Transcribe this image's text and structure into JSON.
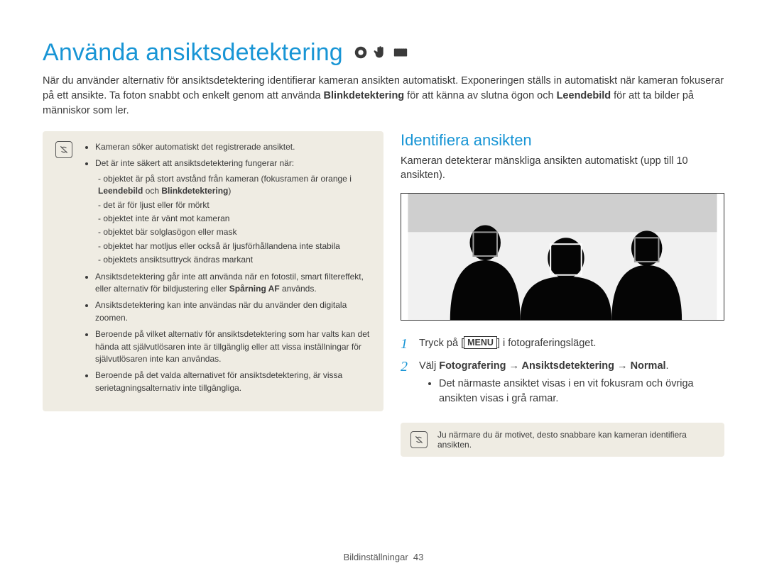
{
  "title": "Använda ansiktsdetektering",
  "title_icons": [
    "camera-mode-icon",
    "hand-icon",
    "scene-icon"
  ],
  "lead": {
    "t1": "När du använder alternativ för ansiktsdetektering identifierar kameran ansikten automatiskt. Exponeringen ställs in automatiskt när kameran fokuserar på ett ansikte. Ta foton snabbt och enkelt genom att använda ",
    "b1": "Blinkdetektering",
    "t2": " för att känna av slutna ögon och ",
    "b2": "Leendebild",
    "t3": " för att ta bilder på människor som ler."
  },
  "notes": {
    "n1": "Kameran söker automatiskt det registrerade ansiktet.",
    "n2": "Det är inte säkert att ansiktsdetektering fungerar när:",
    "sub": {
      "s1a": "objektet är på stort avstånd från kameran (fokusramen är orange i ",
      "s1b1": "Leendebild",
      "s1mid": " och ",
      "s1b2": "Blinkdetektering",
      "s1end": ")",
      "s2": "det är för ljust eller för mörkt",
      "s3": "objektet inte är vänt mot kameran",
      "s4": "objektet bär solglasögon eller mask",
      "s5": "objektet har motljus eller också är ljusförhållandena inte stabila",
      "s6": "objektets ansiktsuttryck ändras markant"
    },
    "n3a": "Ansiktsdetektering går inte att använda när en fotostil, smart filtereffekt, eller alternativ för bildjustering eller ",
    "n3b": "Spårning AF",
    "n3c": " används.",
    "n4": "Ansiktsdetektering kan inte användas när du använder den digitala zoomen.",
    "n5": "Beroende på vilket alternativ för ansiktsdetektering som har valts kan det hända att självutlösaren inte är tillgänglig eller att vissa inställningar för självutlösaren inte kan användas.",
    "n6": "Beroende på det valda alternativet för ansiktsdetektering, är vissa serietagningsalternativ inte tillgängliga."
  },
  "right": {
    "heading": "Identifiera ansikten",
    "lead": "Kameran detekterar mänskliga ansikten automatiskt (upp till 10 ansikten).",
    "step1_a": "Tryck på [",
    "step1_menu": "MENU",
    "step1_b": "] i fotograferingsläget.",
    "step2_a": "Välj ",
    "step2_b": "Fotografering → Ansiktsdetektering → Normal",
    "step2_c": ".",
    "bullet": "Det närmaste ansiktet visas i en vit fokusram och övriga ansikten visas i grå ramar.",
    "tip": "Ju närmare du är motivet, desto snabbare kan kameran identifiera ansikten."
  },
  "footer": {
    "section": "Bildinställningar",
    "page": "43"
  }
}
